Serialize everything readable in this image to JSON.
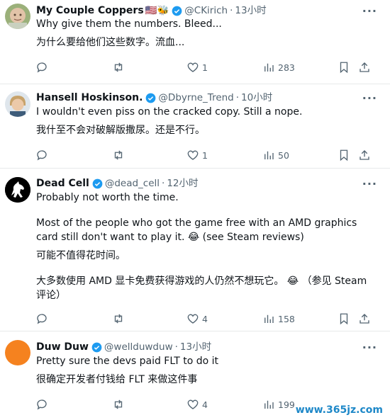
{
  "tweets": [
    {
      "name": "My Couple Coppers",
      "emoji": "🇺🇸🐝",
      "handle": "@CKirich",
      "time": "13小时",
      "lines": [
        "Why give them the numbers. Bleed...",
        "为什么要给他们这些数字。流血..."
      ],
      "likes": "1",
      "views": "283"
    },
    {
      "name": "Hansell Hoskinson.",
      "handle": "@Dbyrne_Trend",
      "time": "10小时",
      "lines": [
        "I wouldn't even piss on the cracked copy. Still a nope.",
        "我什至不会对破解版撒尿。还是不行。"
      ],
      "likes": "1",
      "views": "50"
    },
    {
      "name": "Dead Cell",
      "handle": "@dead_cell",
      "time": "12小时",
      "lines": [
        "Probably not worth the time.",
        "Most of the people who got the game free with an AMD graphics card still don't want to play it. 😂 (see Steam reviews)",
        "可能不值得花时间。",
        "大多数使用 AMD 显卡免费获得游戏的人仍然不想玩它。 😂 （参见 Steam 评论）"
      ],
      "likes": "4",
      "views": "158"
    },
    {
      "name": "Duw Duw",
      "handle": "@wellduwduw",
      "time": "13小时",
      "lines": [
        "Pretty sure the devs paid FLT to do it",
        "很确定开发者付钱给 FLT 来做这件事"
      ],
      "likes": "4",
      "views": "199"
    }
  ],
  "ui": {
    "dot": "·",
    "more": "···"
  },
  "watermark": "www.365jz.com",
  "colors": {
    "verified": "#1d9bf0",
    "secondary_text": "#536471",
    "avatar_duw": "#f5821f"
  }
}
